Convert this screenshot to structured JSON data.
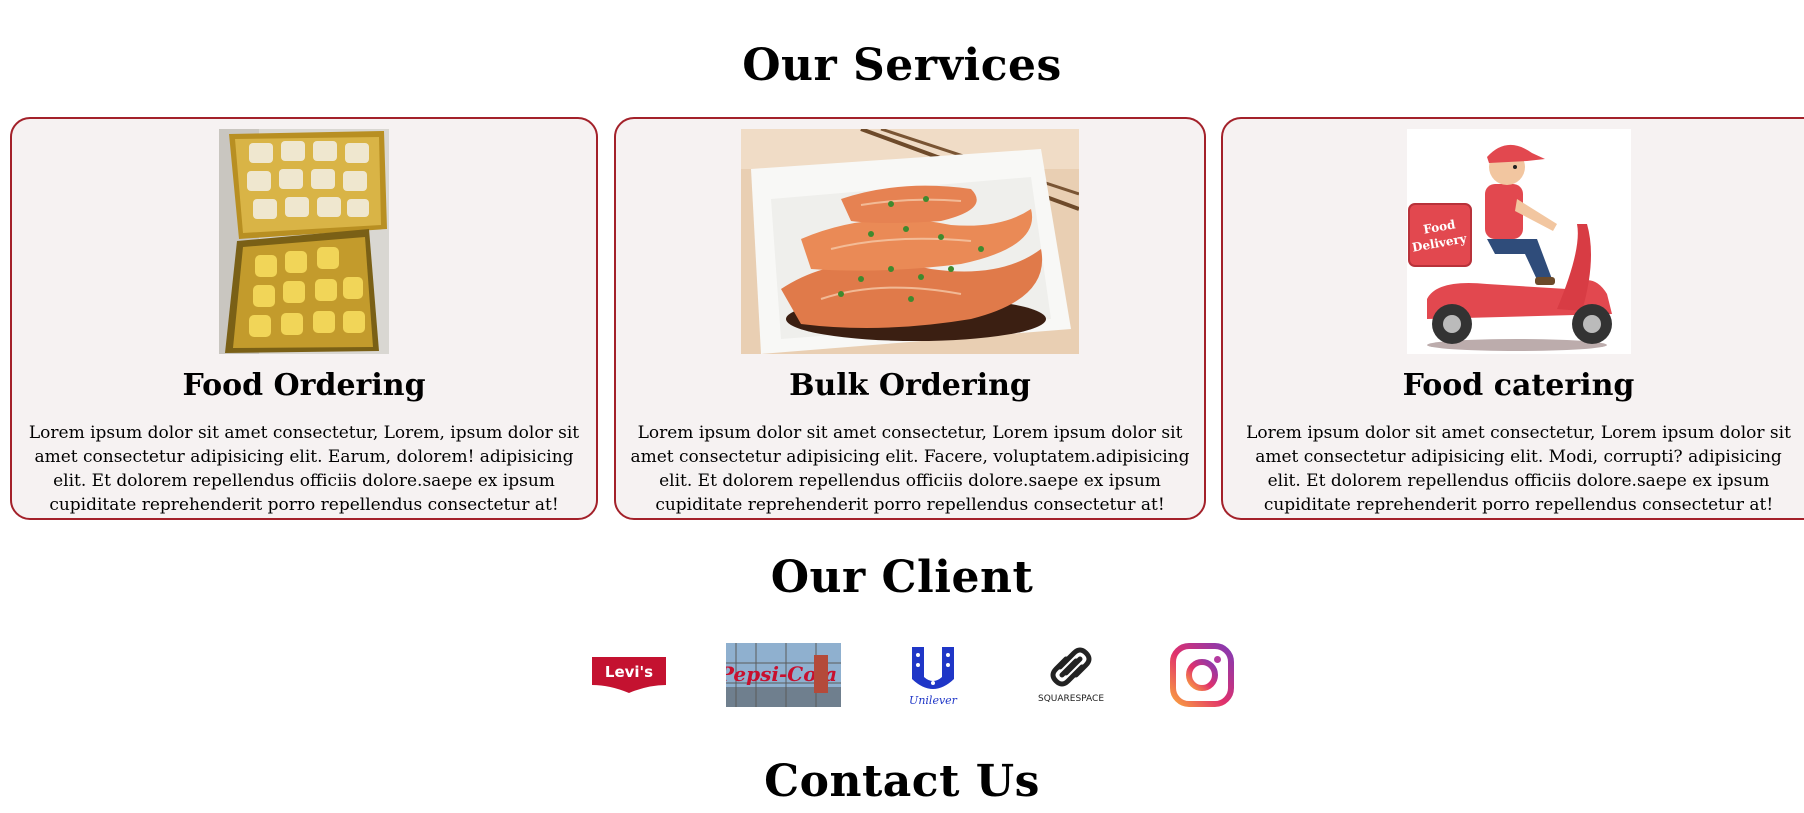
{
  "services": {
    "title": "Our Services",
    "cards": [
      {
        "title": "Food Ordering",
        "text": "Lorem ipsum dolor sit amet consectetur, Lorem, ipsum dolor sit amet consectetur adipisicing elit. Earum, dolorem! adipisicing elit. Et dolorem repellendus officiis dolore.saepe ex ipsum cupiditate reprehenderit porro repellendus consectetur at!"
      },
      {
        "title": "Bulk Ordering",
        "text": "Lorem ipsum dolor sit amet consectetur, Lorem ipsum dolor sit amet consectetur adipisicing elit. Facere, voluptatem.adipisicing elit. Et dolorem repellendus officiis dolore.saepe ex ipsum cupiditate reprehenderit porro repellendus consectetur at!"
      },
      {
        "title": "Food catering",
        "text": "Lorem ipsum dolor sit amet consectetur, Lorem ipsum dolor sit amet consectetur adipisicing elit. Modi, corrupti? adipisicing elit. Et dolorem repellendus officiis dolore.saepe ex ipsum cupiditate reprehenderit porro repellendus consectetur at!"
      }
    ]
  },
  "clients": {
    "title": "Our Client",
    "logos": [
      {
        "name": "Levi's",
        "text": "Levi's",
        "color": "#c41230"
      },
      {
        "name": "Pepsi-Cola sign",
        "text": "Pepsi-Cola",
        "color": "#c8102e"
      },
      {
        "name": "Unilever",
        "text": "Unilever",
        "color": "#1f36c7"
      },
      {
        "name": "Squarespace",
        "text": "SQUARESPACE",
        "color": "#222222"
      },
      {
        "name": "Instagram",
        "color": "#e1306c"
      }
    ]
  },
  "contact": {
    "title": "Contact Us"
  },
  "image_labels": {
    "delivery_box": "Food Delivery"
  },
  "colors": {
    "card_border": "#a3212a",
    "card_bg": "#f6f2f2"
  }
}
